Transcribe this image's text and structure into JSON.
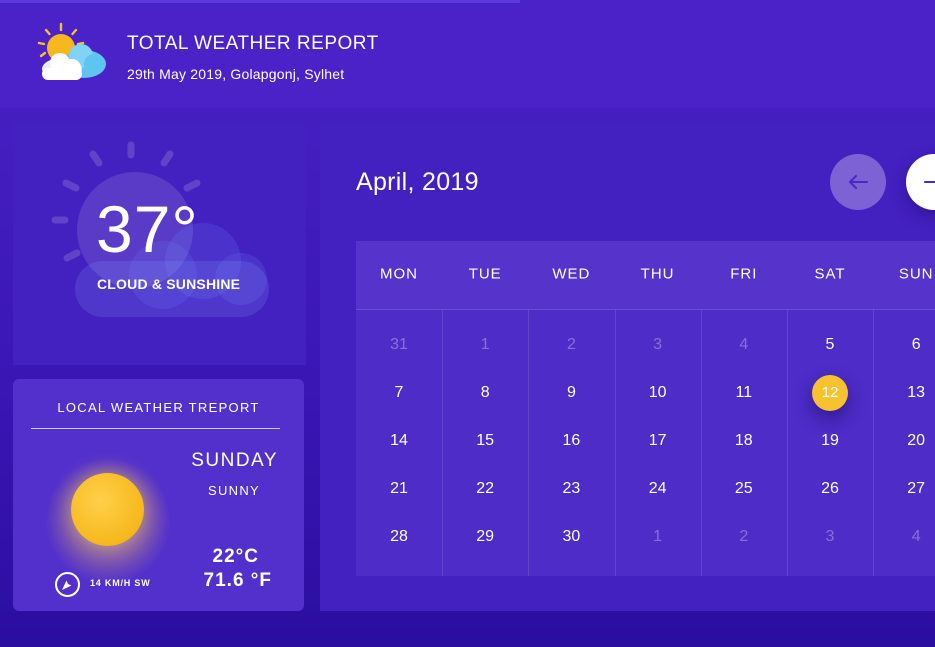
{
  "header": {
    "title": "TOTAL WEATHER REPORT",
    "subtitle": "29th May 2019, Golapgonj, Sylhet",
    "logo_icon": "sun-cloud-icon"
  },
  "current": {
    "temperature": "37°",
    "condition": "CLOUD & SUNSHINE",
    "icon": "sun-behind-cloud-icon"
  },
  "local_report": {
    "title": "LOCAL WEATHER TREPORT",
    "day": "SUNDAY",
    "condition": "SUNNY",
    "temp_c": "22°C",
    "temp_f": "71.6 °F",
    "wind": "14 KM/H SW",
    "icons": [
      "sun-icon",
      "compass-icon"
    ]
  },
  "calendar": {
    "month_label": "April, 2019",
    "prev_icon": "arrow-left-icon",
    "next_icon": "arrow-right-icon",
    "weekdays": [
      "MON",
      "TUE",
      "WED",
      "THU",
      "FRI",
      "SAT",
      "SUN"
    ],
    "selected_day": "12",
    "weeks": [
      [
        {
          "d": "31",
          "muted": true
        },
        {
          "d": "1",
          "muted": true
        },
        {
          "d": "2",
          "muted": true
        },
        {
          "d": "3",
          "muted": true
        },
        {
          "d": "4",
          "muted": true
        },
        {
          "d": "5",
          "muted": false
        },
        {
          "d": "6",
          "muted": false
        }
      ],
      [
        {
          "d": "7",
          "muted": false
        },
        {
          "d": "8",
          "muted": false
        },
        {
          "d": "9",
          "muted": false
        },
        {
          "d": "10",
          "muted": false
        },
        {
          "d": "11",
          "muted": false
        },
        {
          "d": "12",
          "muted": false
        },
        {
          "d": "13",
          "muted": false
        }
      ],
      [
        {
          "d": "14",
          "muted": false
        },
        {
          "d": "15",
          "muted": false
        },
        {
          "d": "16",
          "muted": false
        },
        {
          "d": "17",
          "muted": false
        },
        {
          "d": "18",
          "muted": false
        },
        {
          "d": "19",
          "muted": false
        },
        {
          "d": "20",
          "muted": false
        }
      ],
      [
        {
          "d": "21",
          "muted": false
        },
        {
          "d": "22",
          "muted": false
        },
        {
          "d": "23",
          "muted": false
        },
        {
          "d": "24",
          "muted": false
        },
        {
          "d": "25",
          "muted": false
        },
        {
          "d": "26",
          "muted": false
        },
        {
          "d": "27",
          "muted": false
        }
      ],
      [
        {
          "d": "28",
          "muted": false
        },
        {
          "d": "29",
          "muted": false
        },
        {
          "d": "30",
          "muted": false
        },
        {
          "d": "1",
          "muted": true
        },
        {
          "d": "2",
          "muted": true
        },
        {
          "d": "3",
          "muted": true
        },
        {
          "d": "4",
          "muted": true
        }
      ]
    ]
  },
  "colors": {
    "background": "#4320c0",
    "accent_today": "#f6c22e",
    "button_prev": "#7d62d6",
    "button_next": "#ffffff"
  }
}
